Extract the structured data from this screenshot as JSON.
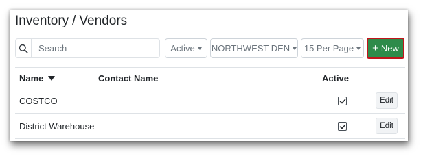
{
  "breadcrumb": {
    "parent": "Inventory",
    "separator": "/",
    "current": "Vendors"
  },
  "search": {
    "placeholder": "Search",
    "value": "",
    "icon": "search-icon"
  },
  "filters": {
    "active": {
      "label": "Active"
    },
    "region": {
      "label": "NORTHWEST DEN"
    },
    "per_page": {
      "label": "15 Per Page"
    }
  },
  "new_button": {
    "icon": "+",
    "label": "New",
    "color": "#2e8b4a",
    "highlight_color": "#c0161c"
  },
  "table": {
    "columns": {
      "name": "Name",
      "contact_name": "Contact Name",
      "active": "Active"
    },
    "sort": {
      "column": "name",
      "direction": "descending"
    },
    "rows": [
      {
        "name": "COSTCO",
        "contact_name": "",
        "active": true,
        "action": "Edit"
      },
      {
        "name": "District Warehouse",
        "contact_name": "",
        "active": true,
        "action": "Edit"
      }
    ]
  }
}
